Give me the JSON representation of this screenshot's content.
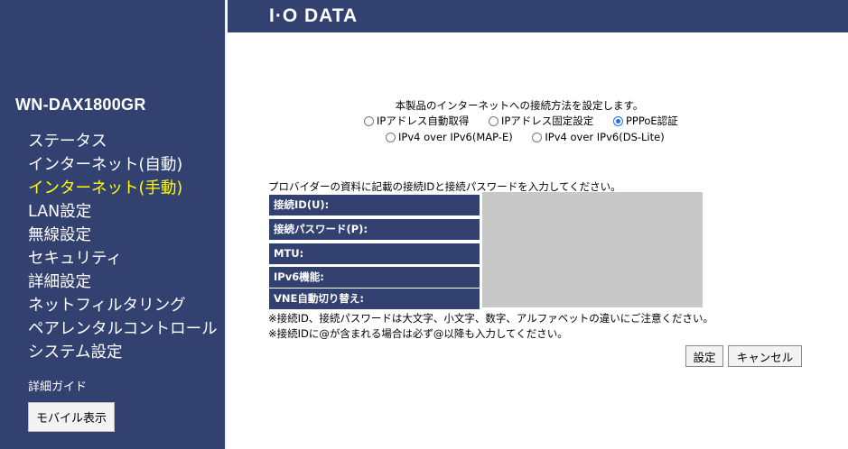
{
  "sidebar": {
    "model": "WN-DAX1800GR",
    "items": [
      {
        "label": "ステータス"
      },
      {
        "label": "インターネット(自動)"
      },
      {
        "label": "インターネット(手動)",
        "active": true
      },
      {
        "label": "LAN設定"
      },
      {
        "label": "無線設定"
      },
      {
        "label": "セキュリティ"
      },
      {
        "label": "詳細設定"
      },
      {
        "label": "ネットフィルタリング"
      },
      {
        "label": "ペアレンタルコントロール"
      },
      {
        "label": "システム設定"
      }
    ],
    "guide": "詳細ガイド",
    "mobile_button": "モバイル表示"
  },
  "header": {
    "logo": "I·O DATA"
  },
  "main": {
    "intro": "本製品のインターネットへの接続方法を設定します。",
    "methods": [
      {
        "label": "IPアドレス自動取得",
        "checked": false
      },
      {
        "label": "IPアドレス固定設定",
        "checked": false
      },
      {
        "label": "PPPoE認証",
        "checked": true
      },
      {
        "label": "IPv4 over IPv6(MAP-E)",
        "checked": false
      },
      {
        "label": "IPv4 over IPv6(DS-Lite)",
        "checked": false
      }
    ],
    "provider_note": "プロバイダーの資料に記載の接続IDと接続パスワードを入力してください。",
    "fields": {
      "id": "接続ID(U):",
      "password": "接続パスワード(P):",
      "mtu": "MTU:",
      "ipv6": "IPv6機能:",
      "vne": "VNE自動切り替え:"
    },
    "notes": {
      "case": "※接続ID、接続パスワードは大文字、小文字、数字、アルファベットの違いにご注意ください。",
      "at": "※接続IDに@が含まれる場合は必ず@以降も入力してください。"
    },
    "buttons": {
      "apply": "設定",
      "cancel": "キャンセル"
    }
  },
  "colors": {
    "navy": "#334170",
    "active_nav": "#ffff00",
    "placeholder_panel": "#c8c8c8"
  }
}
